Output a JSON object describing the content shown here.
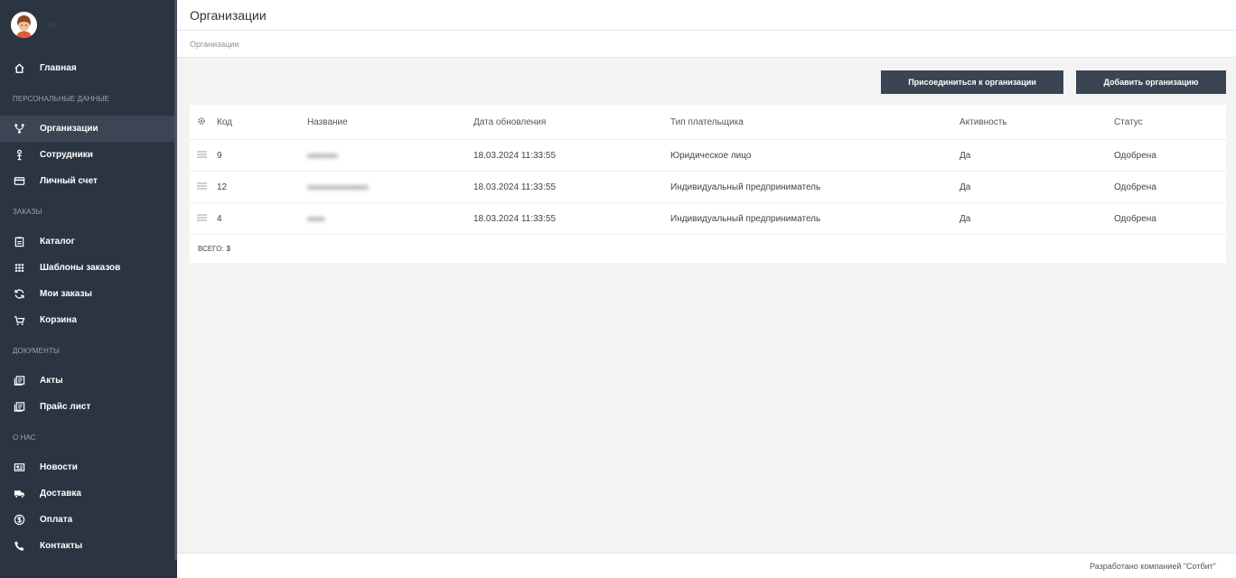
{
  "profile": {
    "name": "—"
  },
  "sidebar": {
    "items": [
      {
        "label": "Главная"
      },
      {
        "label": "Организации"
      },
      {
        "label": "Сотрудники"
      },
      {
        "label": "Личный счет"
      },
      {
        "label": "Каталог"
      },
      {
        "label": "Шаблоны заказов"
      },
      {
        "label": "Мои заказы"
      },
      {
        "label": "Корзина"
      },
      {
        "label": "Акты"
      },
      {
        "label": "Прайс лист"
      },
      {
        "label": "Новости"
      },
      {
        "label": "Доставка"
      },
      {
        "label": "Оплата"
      },
      {
        "label": "Контакты"
      }
    ],
    "sections": [
      "ПЕРСОНАЛЬНЫЕ ДАННЫЕ",
      "ЗАКАЗЫ",
      "ДОКУМЕНТЫ",
      "О НАС"
    ]
  },
  "header": {
    "title": "Организации"
  },
  "breadcrumb": {
    "label": "Организации"
  },
  "actions": {
    "join_label": "Присоединиться к организации",
    "add_label": "Добавить организацию"
  },
  "table": {
    "columns": [
      "Код",
      "Название",
      "Дата обновления",
      "Тип плательщика",
      "Активность",
      "Статус"
    ],
    "rows": [
      {
        "code": "9",
        "name": "",
        "updated": "18.03.2024 11:33:55",
        "payer_type": "Юридическое лицо",
        "active": "Да",
        "status": "Одобрена"
      },
      {
        "code": "12",
        "name": "",
        "updated": "18.03.2024 11:33:55",
        "payer_type": "Индивидуальный предприниматель",
        "active": "Да",
        "status": "Одобрена"
      },
      {
        "code": "4",
        "name": "",
        "updated": "18.03.2024 11:33:55",
        "payer_type": "Индивидуальный предприниматель",
        "active": "Да",
        "status": "Одобрена"
      }
    ],
    "total_label": "ВСЕГО:",
    "total_value": "3"
  },
  "footer": {
    "text": "Разработано компанией \"Сотбит\""
  },
  "colors": {
    "sidebar_bg": "#2b3441",
    "button_bg": "#3b4453",
    "page_bg": "#f3f3f4"
  },
  "icons": {
    "home": "home-icon",
    "org": "sitemap-icon",
    "staff": "person-icon",
    "account": "credit-card-icon",
    "catalog": "clipboard-icon",
    "templates": "grid-icon",
    "orders": "refresh-icon",
    "cart": "cart-icon",
    "acts": "document-icon",
    "pricelist": "document-icon",
    "news": "newspaper-icon",
    "delivery": "truck-icon",
    "payment": "dollar-icon",
    "contacts": "phone-icon",
    "settings": "gear-icon",
    "row": "menu-lines-icon"
  }
}
